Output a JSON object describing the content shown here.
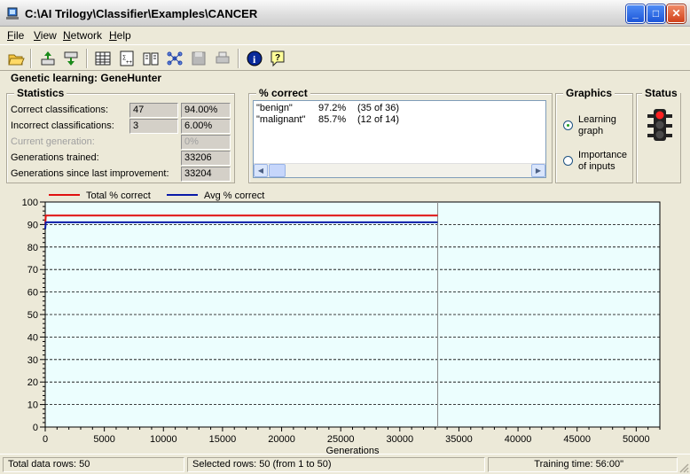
{
  "window": {
    "title": "C:\\AI Trilogy\\Classifier\\Examples\\CANCER",
    "minimize": "_",
    "maximize": "□",
    "close": "✕"
  },
  "menu": [
    {
      "label": "File",
      "ul": "F",
      "rest": "ile"
    },
    {
      "label": "View",
      "ul": "V",
      "rest": "iew"
    },
    {
      "label": "Network",
      "ul": "N",
      "rest": "etwork"
    },
    {
      "label": "Help",
      "ul": "H",
      "rest": "elp"
    }
  ],
  "toolbar": {
    "icons": [
      "open-icon",
      "export-icon",
      "import-icon",
      "grid-icon",
      "calc-icon",
      "book-icon",
      "network-icon",
      "save-icon",
      "print-icon",
      "info-icon",
      "help-icon"
    ]
  },
  "heading": "Genetic learning: GeneHunter",
  "statistics": {
    "title": "Statistics",
    "rows": [
      {
        "label": "Correct classifications:",
        "count": "47",
        "pct": "94.00%",
        "dim": false
      },
      {
        "label": "Incorrect classifications:",
        "count": "3",
        "pct": "6.00%",
        "dim": false
      },
      {
        "label": "Current generation:",
        "count": "",
        "pct": "0%",
        "dim": true
      },
      {
        "label": "Generations trained:",
        "count": "",
        "pct": "33206",
        "dim": false
      },
      {
        "label": "Generations since last improvement:",
        "count": "",
        "pct": "33204",
        "dim": false
      }
    ]
  },
  "pct_correct": {
    "title": "% correct",
    "rows": [
      {
        "name": "\"benign\"",
        "pct": "97.2%",
        "ratio": "(35 of 36)"
      },
      {
        "name": "\"malignant\"",
        "pct": "85.7%",
        "ratio": "(12 of 14)"
      }
    ]
  },
  "graphics": {
    "title": "Graphics",
    "options": [
      {
        "label1": "Learning",
        "label2": "graph",
        "selected": true
      },
      {
        "label1": "Importance",
        "label2": "of inputs",
        "selected": false
      }
    ]
  },
  "status": {
    "title": "Status",
    "light": "red"
  },
  "chart_data": {
    "type": "line",
    "title": "",
    "xlabel": "Generations",
    "ylabel": "",
    "xlim": [
      0,
      52000
    ],
    "ylim": [
      0,
      100
    ],
    "xticks": [
      0,
      5000,
      10000,
      15000,
      20000,
      25000,
      30000,
      35000,
      40000,
      45000,
      50000
    ],
    "yticks": [
      0,
      10,
      20,
      30,
      40,
      50,
      60,
      70,
      80,
      90,
      100
    ],
    "grid": true,
    "legend": "top-left",
    "current_generation": 33206,
    "series": [
      {
        "name": "Total % correct",
        "color": "#e01010",
        "points": [
          [
            0,
            90
          ],
          [
            50,
            94
          ],
          [
            33206,
            94
          ]
        ]
      },
      {
        "name": "Avg % correct",
        "color": "#0a1aa8",
        "points": [
          [
            0,
            88
          ],
          [
            50,
            91
          ],
          [
            33206,
            91
          ]
        ]
      }
    ]
  },
  "statusbar": {
    "total": "Total data rows: 50",
    "selected": "Selected rows: 50  (from 1 to 50)",
    "time": "Training time: 56:00\""
  }
}
